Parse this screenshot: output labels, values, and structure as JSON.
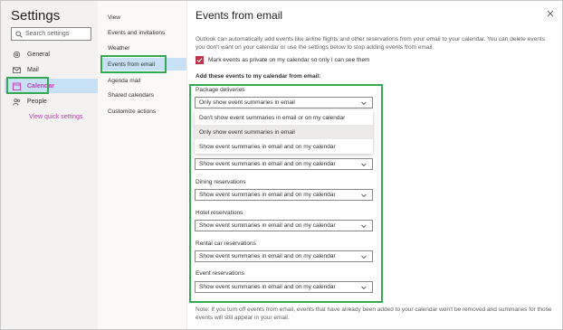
{
  "sidebar": {
    "title": "Settings",
    "search_placeholder": "Search settings",
    "items": [
      {
        "label": "General"
      },
      {
        "label": "Mail"
      },
      {
        "label": "Calendar"
      },
      {
        "label": "People"
      }
    ],
    "quick_settings": "View quick settings"
  },
  "subnav": {
    "items": [
      {
        "label": "View"
      },
      {
        "label": "Events and invitations"
      },
      {
        "label": "Weather"
      },
      {
        "label": "Events from email"
      },
      {
        "label": "Agenda mail"
      },
      {
        "label": "Shared calendars"
      },
      {
        "label": "Customize actions"
      }
    ]
  },
  "panel": {
    "title": "Events from email",
    "close_icon": "close-icon",
    "description": "Outlook can automatically add events like airline flights and other reservations from your email to your calendar. You can delete events you don't want on your calendar or use the settings below to stop adding events from email.",
    "private_label": "Mark events as private on my calendar so only I can see them",
    "private_checked": true,
    "section_title": "Add these events to my calendar from email:",
    "categories": [
      {
        "label": "Package deliveries",
        "value": "Only show event summaries in email"
      },
      {
        "label": "",
        "value": "Show event summaries in email and on my calendar"
      },
      {
        "label": "Dining reservations",
        "value": "Show event summaries in email and on my calendar"
      },
      {
        "label": "Hotel reservations",
        "value": "Show event summaries in email and on my calendar"
      },
      {
        "label": "Rental car reservations",
        "value": "Show event summaries in email and on my calendar"
      },
      {
        "label": "Event reservations",
        "value": "Show event summaries in email and on my calendar"
      }
    ],
    "dropdown_options": [
      "Don't show event summaries in email or on my calendar",
      "Only show event summaries in email",
      "Show event summaries in email and on my calendar"
    ],
    "dropdown_selected_index": 1,
    "note": "Note: If you turn off events from email, events that have already been added to your calendar won't be removed and summaries for those events will still appear in your email."
  },
  "colors": {
    "accent": "#0078d4",
    "active_bg": "#c7e0f4",
    "highlight_box": "#34a853",
    "checkbox": "#c4314b",
    "link": "#c239b3"
  }
}
